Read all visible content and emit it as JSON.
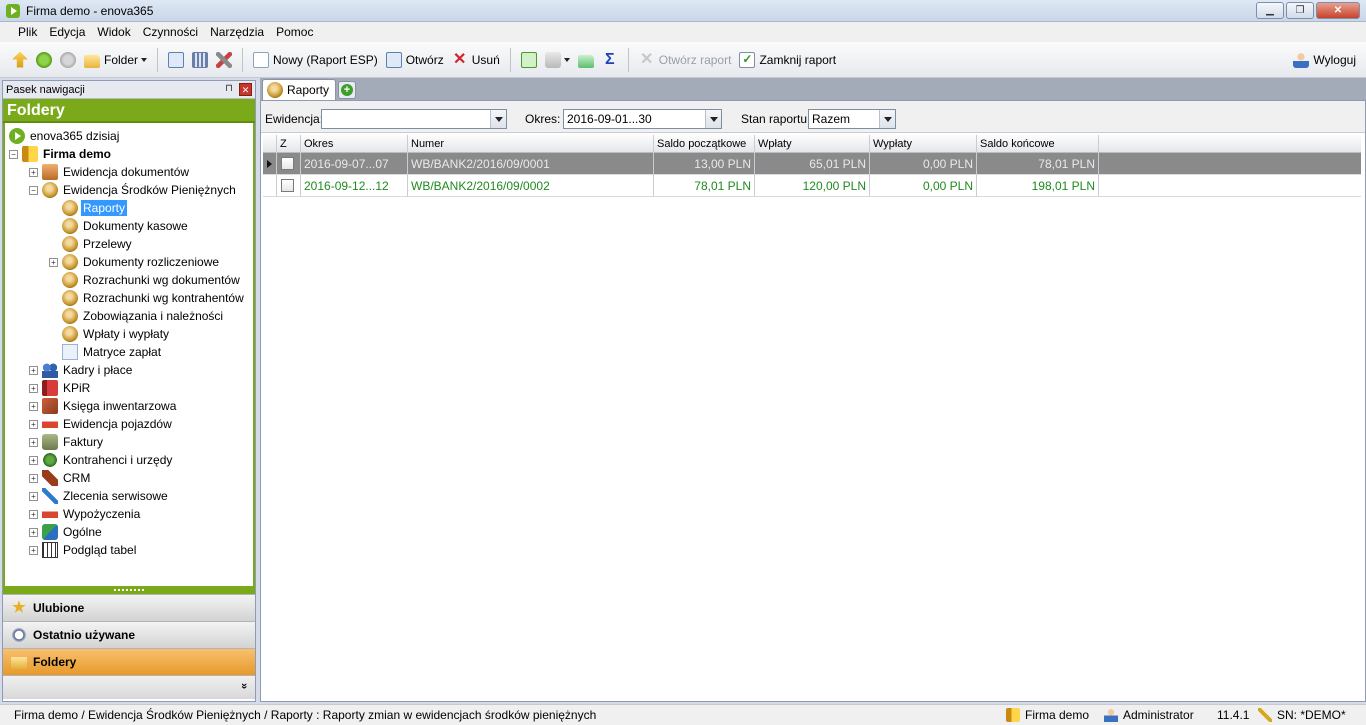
{
  "window": {
    "title": "Firma demo - enova365",
    "minimize": "▁",
    "maximize": "❐",
    "close": "✕"
  },
  "menu": [
    "Plik",
    "Edycja",
    "Widok",
    "Czynności",
    "Narzędzia",
    "Pomoc"
  ],
  "toolbar": {
    "folder_label": "Folder",
    "new_label": "Nowy (Raport ESP)",
    "open_label": "Otwórz",
    "delete_label": "Usuń",
    "open_report_label": "Otwórz raport",
    "close_report_label": "Zamknij raport",
    "logout_label": "Wyloguj"
  },
  "nav": {
    "header": "Pasek nawigacji",
    "pin": "⊓",
    "close": "✕",
    "title": "Foldery",
    "tree": [
      {
        "label": "enova365 dzisiaj",
        "level": 0,
        "icon": "go-icon",
        "expander": "",
        "bold": false,
        "selected": false
      },
      {
        "label": "Firma demo",
        "level": 0,
        "icon": "firm-icon",
        "expander": "−",
        "bold": true,
        "selected": false
      },
      {
        "label": "Ewidencja dokumentów",
        "level": 1,
        "icon": "box-icon",
        "expander": "+",
        "bold": false,
        "selected": false
      },
      {
        "label": "Ewidencja Środków Pieniężnych",
        "level": 1,
        "icon": "coin-icon",
        "expander": "−",
        "bold": false,
        "selected": false
      },
      {
        "label": "Raporty",
        "level": 2,
        "icon": "coin-icon",
        "expander": "",
        "bold": false,
        "selected": true
      },
      {
        "label": "Dokumenty kasowe",
        "level": 2,
        "icon": "coin-icon",
        "expander": "",
        "bold": false,
        "selected": false
      },
      {
        "label": "Przelewy",
        "level": 2,
        "icon": "coin-icon",
        "expander": "",
        "bold": false,
        "selected": false
      },
      {
        "label": "Dokumenty rozliczeniowe",
        "level": 2,
        "icon": "coin-icon",
        "expander": "+",
        "bold": false,
        "selected": false
      },
      {
        "label": "Rozrachunki wg dokumentów",
        "level": 2,
        "icon": "coin-icon",
        "expander": "",
        "bold": false,
        "selected": false
      },
      {
        "label": "Rozrachunki wg kontrahentów",
        "level": 2,
        "icon": "coin-icon",
        "expander": "",
        "bold": false,
        "selected": false
      },
      {
        "label": "Zobowiązania i należności",
        "level": 2,
        "icon": "coin-icon",
        "expander": "",
        "bold": false,
        "selected": false
      },
      {
        "label": "Wpłaty i wypłaty",
        "level": 2,
        "icon": "coin-icon",
        "expander": "",
        "bold": false,
        "selected": false
      },
      {
        "label": "Matryce zapłat",
        "level": 2,
        "icon": "page-icon",
        "expander": "",
        "bold": false,
        "selected": false
      },
      {
        "label": "Kadry i płace",
        "level": 1,
        "icon": "people-icon",
        "expander": "+",
        "bold": false,
        "selected": false
      },
      {
        "label": "KPiR",
        "level": 1,
        "icon": "book-icon",
        "expander": "+",
        "bold": false,
        "selected": false
      },
      {
        "label": "Księga inwentarzowa",
        "level": 1,
        "icon": "crate-icon",
        "expander": "+",
        "bold": false,
        "selected": false
      },
      {
        "label": "Ewidencja pojazdów",
        "level": 1,
        "icon": "car-icon",
        "expander": "+",
        "bold": false,
        "selected": false
      },
      {
        "label": "Faktury",
        "level": 1,
        "icon": "money-icon",
        "expander": "+",
        "bold": false,
        "selected": false
      },
      {
        "label": "Kontrahenci i urzędy",
        "level": 1,
        "icon": "contact-icon",
        "expander": "+",
        "bold": false,
        "selected": false
      },
      {
        "label": "CRM",
        "level": 1,
        "icon": "phone-icon",
        "expander": "+",
        "bold": false,
        "selected": false
      },
      {
        "label": "Zlecenia serwisowe",
        "level": 1,
        "icon": "wrench-icon",
        "expander": "+",
        "bold": false,
        "selected": false
      },
      {
        "label": "Wypożyczenia",
        "level": 1,
        "icon": "car-icon",
        "expander": "+",
        "bold": false,
        "selected": false
      },
      {
        "label": "Ogólne",
        "level": 1,
        "icon": "puzzle-icon",
        "expander": "+",
        "bold": false,
        "selected": false
      },
      {
        "label": "Podgląd tabel",
        "level": 1,
        "icon": "table-icon",
        "expander": "+",
        "bold": false,
        "selected": false
      }
    ],
    "buttons": {
      "favorites": "Ulubione",
      "recent": "Ostatnio używane",
      "folders": "Foldery"
    },
    "footer_chevron": "»"
  },
  "tabs": {
    "active": "Raporty",
    "add": "+"
  },
  "filters": {
    "ewidencja_label": "Ewidencja:",
    "ewidencja_value": "",
    "okres_label": "Okres:",
    "okres_value": "2016-09-01...30",
    "stan_label": "Stan raportu:",
    "stan_value": "Razem"
  },
  "grid": {
    "columns": {
      "z": "Z",
      "okres": "Okres",
      "numer": "Numer",
      "saldo_pocz": "Saldo początkowe",
      "wplaty": "Wpłaty",
      "wyplaty": "Wypłaty",
      "saldo_konc": "Saldo końcowe"
    },
    "rows": [
      {
        "okres": "2016-09-07...07",
        "numer": "WB/BANK2/2016/09/0001",
        "saldo_pocz": "13,00 PLN",
        "wplaty": "65,01 PLN",
        "wyplaty": "0,00 PLN",
        "saldo_konc": "78,01 PLN"
      },
      {
        "okres": "2016-09-12...12",
        "numer": "WB/BANK2/2016/09/0002",
        "saldo_pocz": "78,01 PLN",
        "wplaty": "120,00 PLN",
        "wyplaty": "0,00 PLN",
        "saldo_konc": "198,01 PLN"
      }
    ]
  },
  "status": {
    "path": "Firma demo / Ewidencja Środków Pieniężnych / Raporty : Raporty zmian w ewidencjach środków pieniężnych",
    "company": "Firma demo",
    "user": "Administrator",
    "version": "11.4.1",
    "serial": "SN: *DEMO*"
  },
  "colors": {
    "accent_green": "#7aaa1a",
    "active_orange": "#e79a2a",
    "row_selected": "#8a8a8a",
    "row_green_text": "#1f8a1f"
  }
}
